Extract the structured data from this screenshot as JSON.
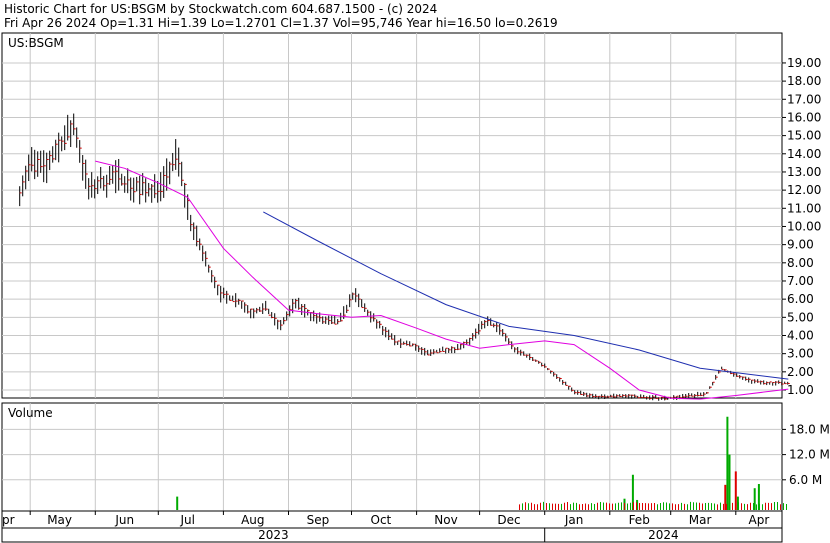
{
  "header": {
    "line1": "Historic Chart for US:BSGM by Stockwatch.com 604.687.1500 - (c) 2024",
    "line2": "Fri Apr 26 2024  Op=1.31  Hi=1.39  Lo=1.2701  Cl=1.37  Vol=95,746  Year hi=16.50  lo=0.2619"
  },
  "colors": {
    "price_bar": "#000000",
    "price_tick": "#cc0000",
    "ma_short": "#e000e0",
    "ma_long": "#1f2fb0",
    "volume_bar": "#00aa00",
    "volume_bar_down": "#dd0000",
    "grid": "#c8c8c8"
  },
  "chart_data": [
    {
      "type": "line",
      "title": "US:BSGM",
      "ylim": [
        0,
        20
      ],
      "y_ticks": [
        "19.00",
        "18.00",
        "17.00",
        "16.00",
        "15.00",
        "14.00",
        "13.00",
        "12.00",
        "11.00",
        "10.00",
        "9.00",
        "8.00",
        "7.00",
        "6.00",
        "5.00",
        "4.00",
        "3.00",
        "2.00",
        "1.00"
      ],
      "month_labels": [
        "pr",
        "May",
        "Jun",
        "Jul",
        "Aug",
        "Sep",
        "Oct",
        "Nov",
        "Dec",
        "Jan",
        "Feb",
        "Mar",
        "Apr"
      ],
      "year_labels": [
        "2023",
        "2024"
      ],
      "grid": true,
      "series": [
        {
          "role": "price",
          "x": [
            "2023-04-26",
            "2023-05-01",
            "2023-05-08",
            "2023-05-15",
            "2023-05-22",
            "2023-05-29",
            "2023-06-05",
            "2023-06-12",
            "2023-06-19",
            "2023-06-26",
            "2023-07-03",
            "2023-07-10",
            "2023-07-17",
            "2023-07-24",
            "2023-07-31",
            "2023-08-07",
            "2023-08-14",
            "2023-08-21",
            "2023-08-28",
            "2023-09-04",
            "2023-09-11",
            "2023-09-18",
            "2023-09-25",
            "2023-10-02",
            "2023-10-09",
            "2023-10-16",
            "2023-10-23",
            "2023-10-30",
            "2023-11-06",
            "2023-11-13",
            "2023-11-20",
            "2023-11-27",
            "2023-12-04",
            "2023-12-11",
            "2023-12-18",
            "2023-12-25",
            "2024-01-01",
            "2024-01-08",
            "2024-01-15",
            "2024-01-22",
            "2024-01-29",
            "2024-02-05",
            "2024-02-12",
            "2024-02-19",
            "2024-02-26",
            "2024-03-04",
            "2024-03-11",
            "2024-03-18",
            "2024-03-25",
            "2024-04-01",
            "2024-04-08",
            "2024-04-15",
            "2024-04-26"
          ],
          "values": [
            12.0,
            13.5,
            13.2,
            14.5,
            15.5,
            12.0,
            12.5,
            12.8,
            12.2,
            12.0,
            12.3,
            14.0,
            10.0,
            8.0,
            6.2,
            6.0,
            5.3,
            5.5,
            4.5,
            5.8,
            5.2,
            4.8,
            4.7,
            6.3,
            5.2,
            4.3,
            3.6,
            3.5,
            3.0,
            3.2,
            3.3,
            3.8,
            4.8,
            4.3,
            3.2,
            2.8,
            2.3,
            1.6,
            0.9,
            0.7,
            0.6,
            0.7,
            0.65,
            0.6,
            0.55,
            0.6,
            0.7,
            0.8,
            2.2,
            1.8,
            1.5,
            1.4,
            1.37
          ]
        },
        {
          "role": "moving average (short)",
          "x": [
            "2023-06-01",
            "2023-06-15",
            "2023-07-01",
            "2023-07-15",
            "2023-08-01",
            "2023-08-15",
            "2023-09-01",
            "2023-09-15",
            "2023-10-01",
            "2023-10-15",
            "2023-11-01",
            "2023-11-15",
            "2023-12-01",
            "2023-12-15",
            "2024-01-01",
            "2024-01-15",
            "2024-02-01",
            "2024-02-15",
            "2024-03-01",
            "2024-03-15",
            "2024-04-01",
            "2024-04-26"
          ],
          "values": [
            13.6,
            13.2,
            12.4,
            11.6,
            8.8,
            7.2,
            5.4,
            5.2,
            5.0,
            5.1,
            4.4,
            3.8,
            3.3,
            3.5,
            3.7,
            3.5,
            2.2,
            1.0,
            0.55,
            0.5,
            0.7,
            1.05
          ]
        },
        {
          "role": "moving average (long)",
          "x": [
            "2023-08-20",
            "2023-09-15",
            "2023-10-15",
            "2023-11-15",
            "2023-12-15",
            "2024-01-15",
            "2024-02-15",
            "2024-03-15",
            "2024-04-26"
          ],
          "values": [
            10.8,
            9.2,
            7.4,
            5.7,
            4.5,
            4.0,
            3.2,
            2.2,
            1.6
          ]
        }
      ]
    },
    {
      "type": "bar",
      "title": "Volume",
      "y_ticks": [
        "18.0 M",
        "12.0 M",
        "6.0 M"
      ],
      "ylim": [
        0,
        22
      ],
      "series": [
        {
          "name": "Volume",
          "x": [
            "2023-07-10",
            "2024-02-08",
            "2024-02-12",
            "2024-02-14",
            "2024-03-27",
            "2024-03-28",
            "2024-03-29",
            "2024-04-01",
            "2024-04-02",
            "2024-04-10",
            "2024-04-12"
          ],
          "values": [
            2.0,
            1.5,
            7.2,
            1.2,
            4.8,
            21.0,
            12.0,
            8.0,
            2.0,
            4.0,
            5.0
          ]
        }
      ]
    }
  ]
}
